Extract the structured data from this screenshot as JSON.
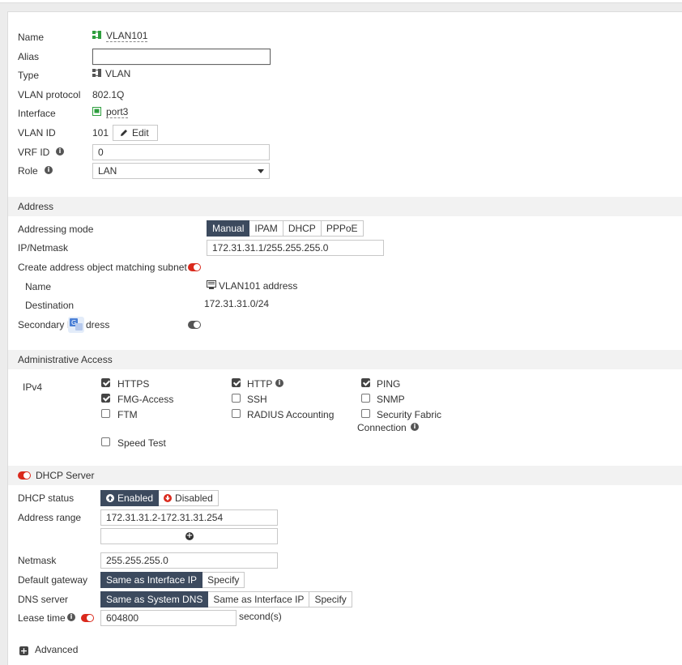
{
  "interface": {
    "name_label": "Name",
    "name_value": "VLAN101",
    "alias_label": "Alias",
    "alias_value": "",
    "type_label": "Type",
    "type_value": "VLAN",
    "vlan_protocol_label": "VLAN protocol",
    "vlan_protocol_value": "802.1Q",
    "interface_label": "Interface",
    "interface_value": "port3",
    "vlan_id_label": "VLAN ID",
    "vlan_id_value": "101",
    "edit_label": "Edit",
    "vrf_id_label": "VRF ID",
    "vrf_id_value": "0",
    "role_label": "Role",
    "role_value": "LAN"
  },
  "address": {
    "section_title": "Address",
    "addressing_mode_label": "Addressing mode",
    "modes": [
      "Manual",
      "IPAM",
      "DHCP",
      "PPPoE"
    ],
    "ip_netmask_label": "IP/Netmask",
    "ip_netmask_value": "172.31.31.1/255.255.255.0",
    "create_object_label": "Create address object matching subnet",
    "object_name_label": "Name",
    "object_name_value": "VLAN101 address",
    "destination_label": "Destination",
    "destination_value": "172.31.31.0/24",
    "secondary_label_a": "Secondary I",
    "secondary_label_b": "dress"
  },
  "admin_access": {
    "section_title": "Administrative Access",
    "ipv4_label": "IPv4",
    "options": {
      "https": "HTTPS",
      "http": "HTTP",
      "ping": "PING",
      "fmg": "FMG-Access",
      "ssh": "SSH",
      "snmp": "SNMP",
      "ftm": "FTM",
      "radius": "RADIUS Accounting",
      "fabric_a": "Security Fabric",
      "fabric_b": "Connection",
      "speed": "Speed Test"
    }
  },
  "dhcp": {
    "section_title": "DHCP Server",
    "status_label": "DHCP status",
    "enabled_label": "Enabled",
    "disabled_label": "Disabled",
    "address_range_label": "Address range",
    "address_range_value": "172.31.31.2-172.31.31.254",
    "netmask_label": "Netmask",
    "netmask_value": "255.255.255.0",
    "gateway_label": "Default gateway",
    "gateway_options": [
      "Same as Interface IP",
      "Specify"
    ],
    "dns_label": "DNS server",
    "dns_options": [
      "Same as System DNS",
      "Same as Interface IP",
      "Specify"
    ],
    "lease_label": "Lease time",
    "lease_value": "604800",
    "lease_unit": "second(s)",
    "advanced_label": "Advanced"
  },
  "colors": {
    "accent_dark": "#3c4a5e",
    "toggle_on": "#da291c",
    "icon_green": "#2e9e3e"
  }
}
